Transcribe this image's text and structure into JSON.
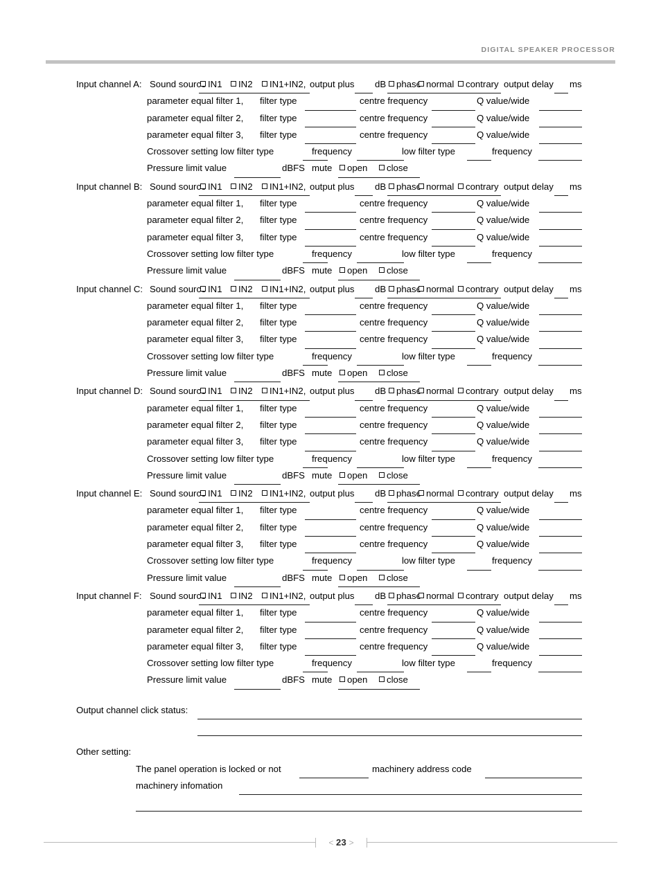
{
  "header": {
    "title": "DIGITAL SPEAKER PROCESSOR"
  },
  "labels": {
    "input_channel_prefix": "Input channel",
    "sound_source": "Sound source",
    "in1": "IN1",
    "in2": "IN2",
    "in1_in2": "IN1+IN2,",
    "output_plus": "output plus",
    "db": "dB",
    "phase": "phase",
    "normal": "normal",
    "contrary": "contrary",
    "output_delay": "output delay",
    "ms": "ms",
    "filter_type": "filter type",
    "centre_frequency": "centre frequency",
    "q_value_wide": "Q value/wide",
    "crossover_setting_low_filter_type": "Crossover setting low filter type",
    "frequency": "frequency",
    "low_filter_type": "low filter type",
    "pressure_limit_value": "Pressure limit value",
    "dbfs": "dBFS",
    "mute": "mute",
    "open": "open",
    "close": "close"
  },
  "channels": [
    {
      "id": "A",
      "header_label": "Input channel A:",
      "filters": [
        {
          "name": "parameter equal filter 1,"
        },
        {
          "name": "parameter equal filter 2,"
        },
        {
          "name": "parameter equal filter 3,"
        }
      ]
    },
    {
      "id": "B",
      "header_label": "Input channel B:",
      "filters": [
        {
          "name": "parameter equal filter 1,"
        },
        {
          "name": "parameter equal filter 2,"
        },
        {
          "name": "parameter equal filter 3,"
        }
      ]
    },
    {
      "id": "C",
      "header_label": "Input channel C:",
      "filters": [
        {
          "name": "parameter equal filter 1,"
        },
        {
          "name": "parameter equal filter 2,"
        },
        {
          "name": "parameter equal filter 3,"
        }
      ]
    },
    {
      "id": "D",
      "header_label": "Input channel D:",
      "filters": [
        {
          "name": "parameter equal filter 1,"
        },
        {
          "name": "parameter equal filter 2,"
        },
        {
          "name": "parameter equal filter 3,"
        }
      ]
    },
    {
      "id": "E",
      "header_label": "Input channel E:",
      "filters": [
        {
          "name": "parameter equal filter 1,"
        },
        {
          "name": "parameter equal filter 2,"
        },
        {
          "name": "parameter equal filter 3,"
        }
      ]
    },
    {
      "id": "F",
      "header_label": "Input channel F:",
      "filters": [
        {
          "name": "parameter equal filter 1,"
        },
        {
          "name": "parameter equal filter 2,"
        },
        {
          "name": "parameter equal filter 3,"
        }
      ]
    }
  ],
  "output_section": {
    "title": "Output channel click status:"
  },
  "other_section": {
    "title": "Other setting:",
    "panel_lock_label": "The panel operation is locked or not",
    "machinery_address_code_label": "machinery address code",
    "machinery_information_label": "machinery infomation"
  },
  "footer": {
    "prev_arrow": "<",
    "page_number": "23",
    "next_arrow": ">"
  },
  "colors": {
    "header_text": "#8a8a8a",
    "header_rule": "#c2c2c2",
    "ink": "#000000",
    "footer_rule": "#b9b9b9"
  }
}
